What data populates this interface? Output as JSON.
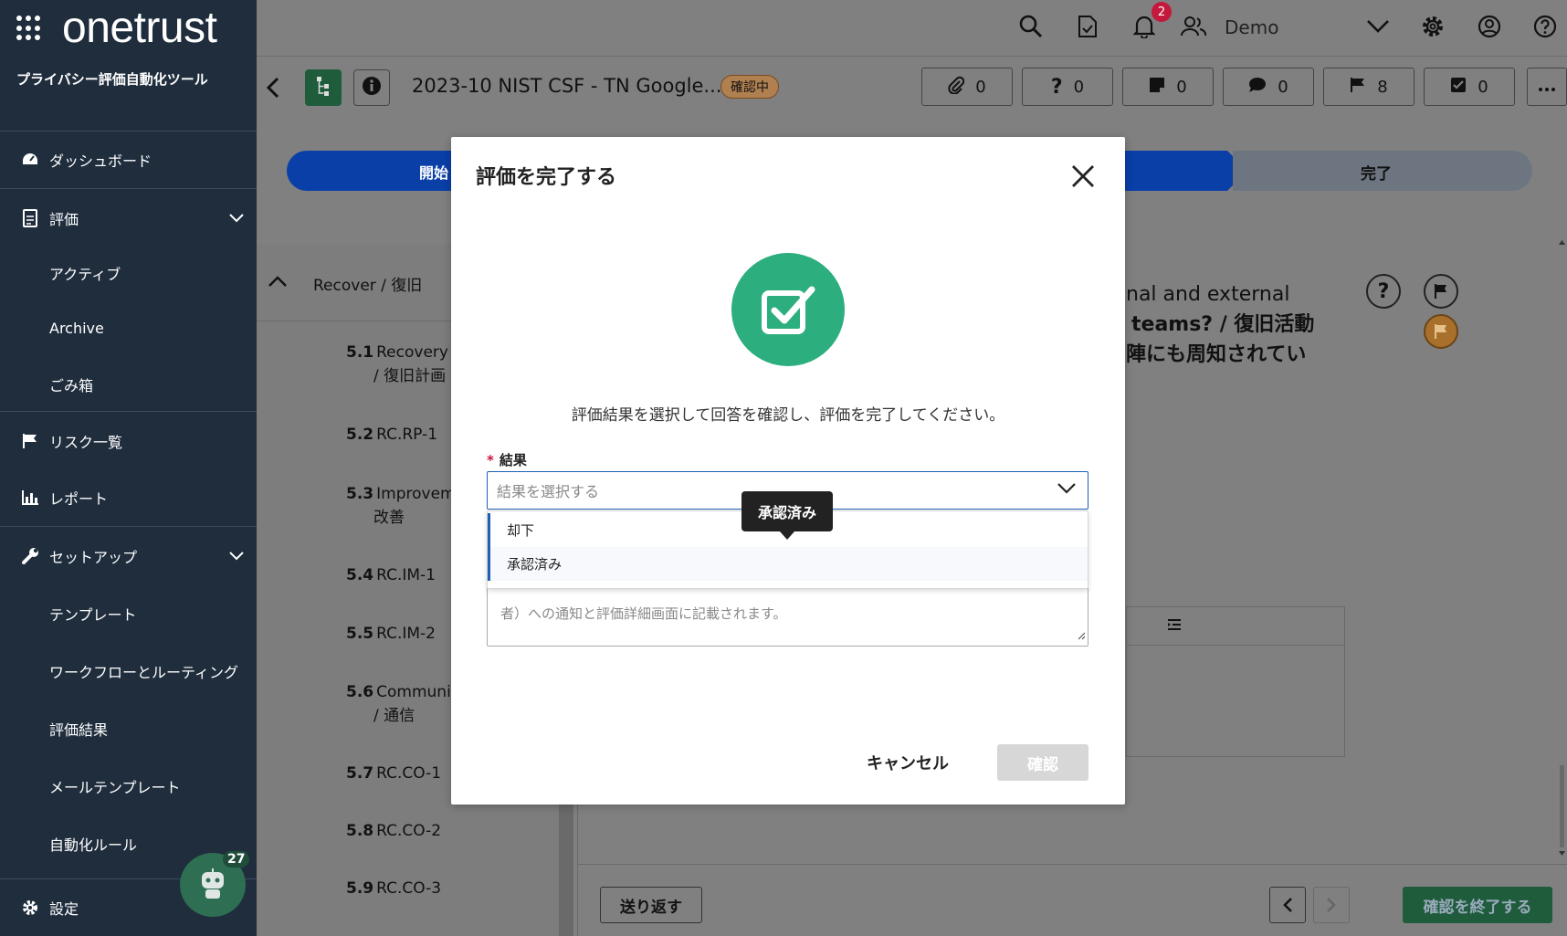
{
  "brand": {
    "logo_text": "onetrust",
    "product_name": "プライバシー評価自動化ツール"
  },
  "sidebar": {
    "items": [
      {
        "label": "ダッシュボード"
      },
      {
        "label": "評価"
      },
      {
        "label": "アクティブ"
      },
      {
        "label": "Archive"
      },
      {
        "label": "ごみ箱"
      },
      {
        "label": "リスク一覧"
      },
      {
        "label": "レポート"
      },
      {
        "label": "セットアップ"
      },
      {
        "label": "テンプレート"
      },
      {
        "label": "ワークフローとルーティング"
      },
      {
        "label": "評価結果"
      },
      {
        "label": "メールテンプレート"
      },
      {
        "label": "自動化ルール"
      }
    ],
    "settings_label": "設定",
    "bot_badge": "27"
  },
  "topbar": {
    "notification_count": "2",
    "user_name": "Demo"
  },
  "subbar": {
    "assessment_title": "2023-10 NIST CSF - TN Google...",
    "status": "確認中",
    "counters": [
      {
        "icon": "paperclip-icon",
        "count": "0"
      },
      {
        "icon": "question-icon",
        "count": "0"
      },
      {
        "icon": "note-icon",
        "count": "0"
      },
      {
        "icon": "comment-icon",
        "count": "0"
      },
      {
        "icon": "flag-icon",
        "count": "8"
      },
      {
        "icon": "task-check-icon",
        "count": "0"
      }
    ]
  },
  "progress": {
    "start_label": "開始",
    "done_label": "完了"
  },
  "section": {
    "label": "Recover / 復旧"
  },
  "questions": [
    {
      "num": "5.1",
      "title": "Recovery P",
      "sub": "/ 復旧計画"
    },
    {
      "num": "5.2",
      "title": "RC.RP-1",
      "sub": ""
    },
    {
      "num": "5.3",
      "title": "Improvem",
      "sub": "改善"
    },
    {
      "num": "5.4",
      "title": "RC.IM-1",
      "sub": ""
    },
    {
      "num": "5.5",
      "title": "RC.IM-2",
      "sub": ""
    },
    {
      "num": "5.6",
      "title": "Communic",
      "sub": "/ 通信"
    },
    {
      "num": "5.7",
      "title": "RC.CO-1",
      "sub": ""
    },
    {
      "num": "5.8",
      "title": "RC.CO-2",
      "sub": ""
    },
    {
      "num": "5.9",
      "title": "RC.CO-3",
      "sub": ""
    }
  ],
  "question_panel": {
    "line1": "nal and external",
    "line2": "teams? / 復旧活動",
    "line3": "陣にも周知されてい"
  },
  "footer": {
    "return_label": "送り返す",
    "finish_label": "確認を終了する"
  },
  "modal": {
    "title": "評価を完了する",
    "description": "評価結果を選択して回答を確認し、評価を完了してください。",
    "field_label": "結果",
    "required_mark": "*",
    "select_placeholder": "結果を選択する",
    "options": [
      "却下",
      "承認済み"
    ],
    "tooltip": "承認済み",
    "textarea_hint": "者）への通知と評価詳細画面に記載されます。",
    "cancel_label": "キャンセル",
    "confirm_label": "確認"
  }
}
